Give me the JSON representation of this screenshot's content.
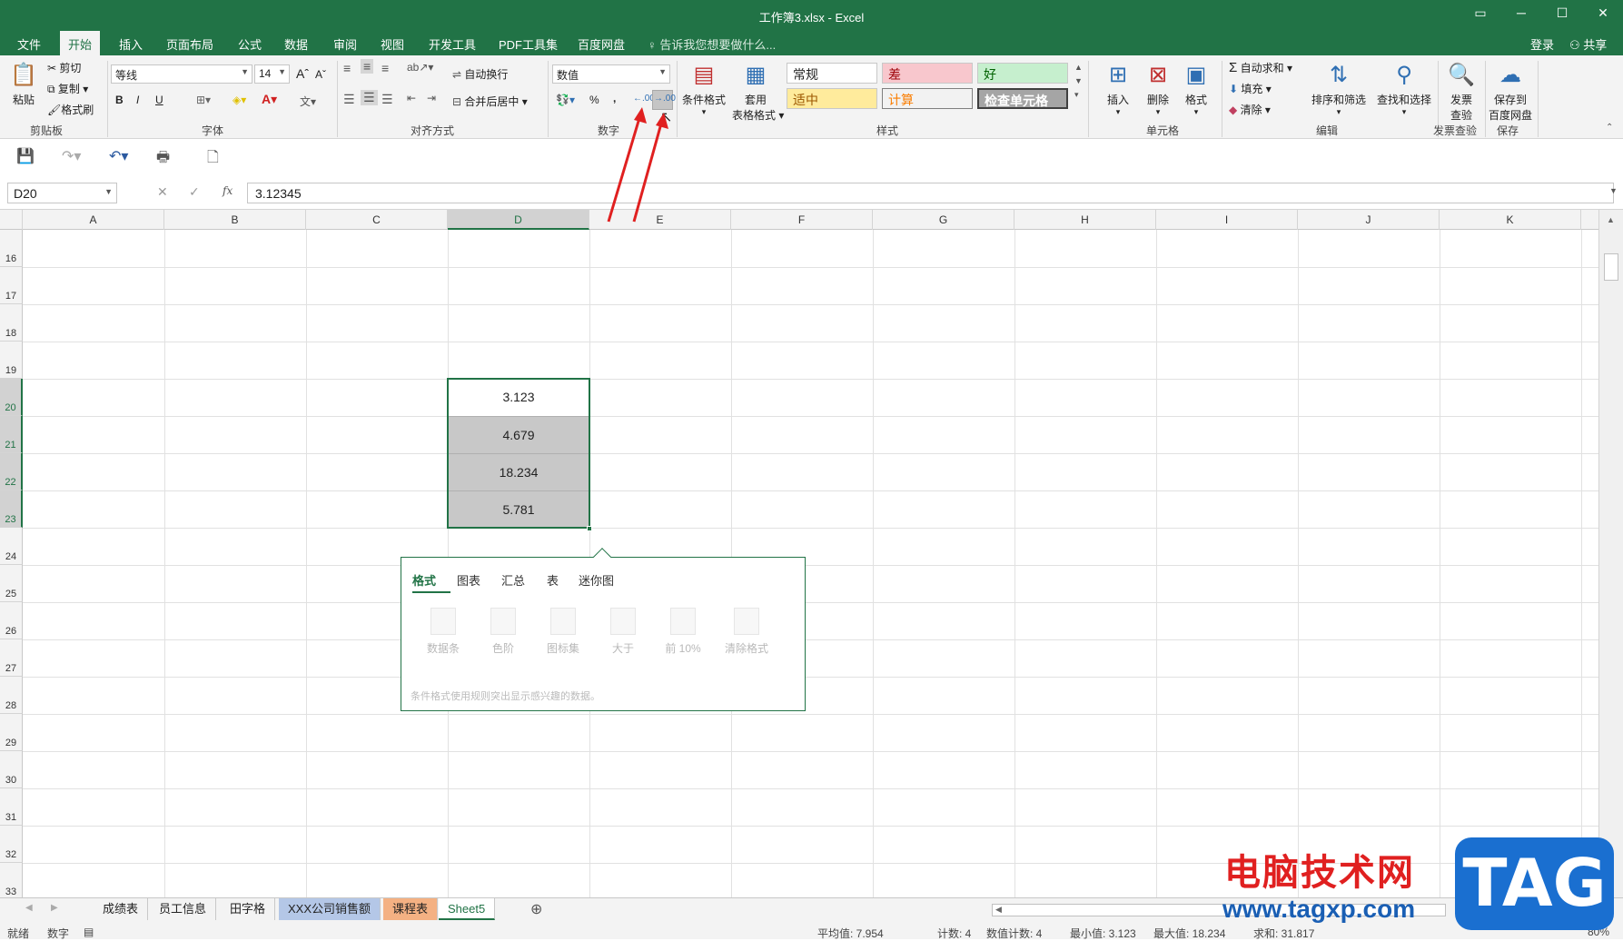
{
  "window": {
    "title": "工作簿3.xlsx - Excel"
  },
  "tabs": [
    "文件",
    "开始",
    "插入",
    "页面布局",
    "公式",
    "数据",
    "审阅",
    "视图",
    "开发工具",
    "PDF工具集",
    "百度网盘"
  ],
  "active_tab": "开始",
  "tell_me": "告诉我您想要做什么...",
  "login": "登录",
  "share": "共享",
  "clipboard": {
    "paste": "粘贴",
    "cut": "剪切",
    "copy": "复制",
    "format_painter": "格式刷",
    "label": "剪贴板"
  },
  "font": {
    "name": "等线",
    "size": "14",
    "bold": "B",
    "italic": "I",
    "underline": "U",
    "label": "字体",
    "grow": "A",
    "shrink": "A"
  },
  "alignment": {
    "wrap": "自动换行",
    "merge": "合并后居中",
    "label": "对齐方式"
  },
  "number": {
    "format": "数值",
    "percent": "%",
    "comma": ",",
    "increase_decimal": ".00",
    "decrease_decimal": ".00",
    "label": "数字"
  },
  "styles": {
    "cond_format": "条件格式",
    "table_format_1": "套用",
    "table_format_2": "表格格式",
    "normal": "常规",
    "bad": "差",
    "good": "好",
    "neutral": "适中",
    "calculation": "计算",
    "check_cell": "检查单元格",
    "label": "样式"
  },
  "cells": {
    "insert": "插入",
    "delete": "删除",
    "format": "格式",
    "label": "单元格"
  },
  "editing": {
    "autosum": "自动求和",
    "fill": "填充",
    "clear": "清除",
    "sort_filter": "排序和筛选",
    "find_select": "查找和选择",
    "label": "编辑"
  },
  "invoice": {
    "btn1": "发票",
    "btn2": "查验",
    "label": "发票查验"
  },
  "save_group": {
    "btn1": "保存到",
    "btn2": "百度网盘",
    "label": "保存"
  },
  "formula_bar": {
    "name_box": "D20",
    "fx": "fx",
    "value": "3.12345"
  },
  "columns": [
    "A",
    "B",
    "C",
    "D",
    "E",
    "F",
    "G",
    "H",
    "I",
    "J",
    "K"
  ],
  "rows": [
    "16",
    "17",
    "18",
    "19",
    "20",
    "21",
    "22",
    "23",
    "24",
    "25",
    "26",
    "27",
    "28",
    "29",
    "30",
    "31",
    "32",
    "33"
  ],
  "cells_data": [
    {
      "row": "20",
      "col": "D",
      "value": "3.123"
    },
    {
      "row": "21",
      "col": "D",
      "value": "4.679"
    },
    {
      "row": "22",
      "col": "D",
      "value": "18.234"
    },
    {
      "row": "23",
      "col": "D",
      "value": "5.781"
    }
  ],
  "quick_analysis": {
    "tabs": [
      "格式",
      "图表",
      "汇总",
      "表",
      "迷你图"
    ],
    "buttons": [
      "数据条",
      "色阶",
      "图标集",
      "大于",
      "前 10%",
      "清除格式"
    ],
    "description": "条件格式使用规则突出显示感兴趣的数据。"
  },
  "sheets": [
    "成绩表",
    "员工信息",
    "田字格",
    "XXX公司销售额",
    "课程表",
    "Sheet5"
  ],
  "active_sheet": "Sheet5",
  "status": {
    "ready": "就绪",
    "mode": "数字",
    "average": "平均值: 7.954",
    "count": "计数: 4",
    "numeric_count": "数值计数: 4",
    "min": "最小值: 3.123",
    "max": "最大值: 18.234",
    "sum": "求和: 31.817",
    "zoom": "80%"
  },
  "watermark": {
    "text": "电脑技术网",
    "url": "www.tagxp.com",
    "logo": "TAG"
  },
  "colors": {
    "excel_green": "#217346",
    "selection_fill": "#c8c8c8",
    "arrow_red": "#e02020"
  }
}
